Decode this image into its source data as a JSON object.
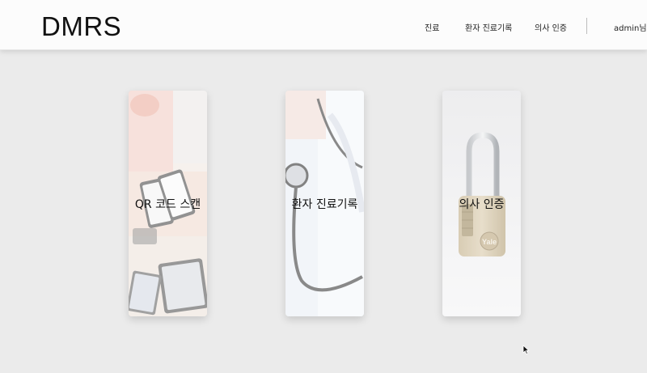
{
  "header": {
    "logo": "DMRS",
    "nav": [
      "진료",
      "환자 진료기록",
      "의사 인증"
    ],
    "user": "admin님"
  },
  "cards": [
    {
      "label": "QR 코드 스캔",
      "image": "phones-photo"
    },
    {
      "label": "환자 진료기록",
      "image": "stethoscope-photo"
    },
    {
      "label": "의사 인증",
      "image": "padlock-photo"
    }
  ],
  "padlock_brand": "Yale",
  "colors": {
    "background": "#ebebeb",
    "header": "#fcfcfc"
  }
}
